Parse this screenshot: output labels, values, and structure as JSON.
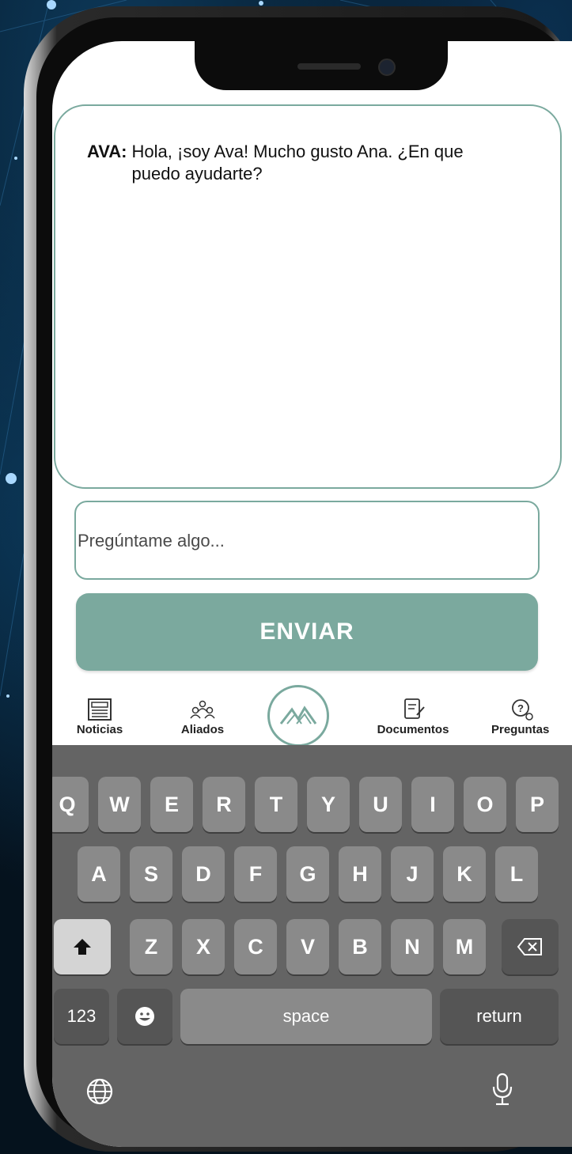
{
  "chat": {
    "speaker": "AVA:",
    "message": "Hola, ¡soy Ava! Mucho gusto Ana. ¿En que puedo ayudarte?"
  },
  "input": {
    "placeholder": "Pregúntame algo...",
    "value": ""
  },
  "send_button": {
    "label": "ENVIAR"
  },
  "nav": {
    "items": [
      {
        "label": "Noticias",
        "icon": "newspaper-icon"
      },
      {
        "label": "Aliados",
        "icon": "people-icon"
      },
      {
        "label": "",
        "icon": "mountain-logo-icon"
      },
      {
        "label": "Documentos",
        "icon": "document-icon"
      },
      {
        "label": "Preguntas",
        "icon": "question-icon"
      }
    ]
  },
  "keyboard": {
    "row1": [
      "Q",
      "W",
      "E",
      "R",
      "T",
      "Y",
      "U",
      "I",
      "O",
      "P"
    ],
    "row2": [
      "A",
      "S",
      "D",
      "F",
      "G",
      "H",
      "J",
      "K",
      "L"
    ],
    "row3": [
      "Z",
      "X",
      "C",
      "V",
      "B",
      "N",
      "M"
    ],
    "numbers_key": "123",
    "space_key": "space",
    "return_key": "return"
  },
  "colors": {
    "accent": "#7ba99e",
    "keyboard_bg": "#646464",
    "key_bg": "#8a8a8a"
  }
}
